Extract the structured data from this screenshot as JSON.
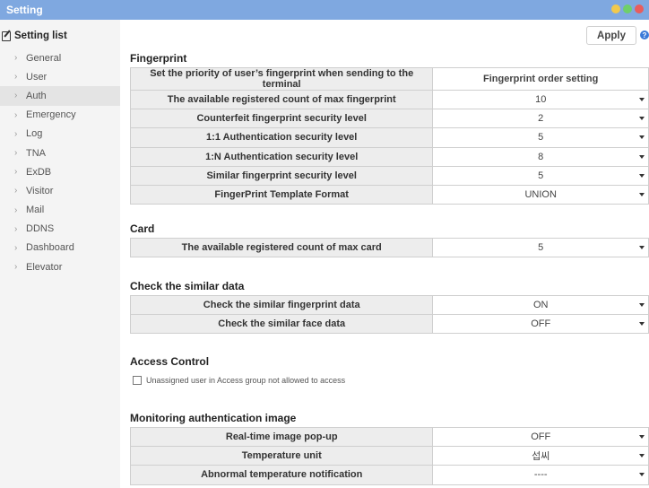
{
  "window": {
    "title": "Setting"
  },
  "sidebar": {
    "header": "Setting list",
    "items": [
      {
        "label": "General"
      },
      {
        "label": "User"
      },
      {
        "label": "Auth",
        "active": true
      },
      {
        "label": "Emergency"
      },
      {
        "label": "Log"
      },
      {
        "label": "TNA"
      },
      {
        "label": "ExDB"
      },
      {
        "label": "Visitor"
      },
      {
        "label": "Mail"
      },
      {
        "label": "DDNS"
      },
      {
        "label": "Dashboard"
      },
      {
        "label": "Elevator"
      }
    ]
  },
  "toolbar": {
    "apply_label": "Apply",
    "help_icon": "?"
  },
  "fingerprint": {
    "title": "Fingerprint",
    "priority_label": "Set the priority of user’s fingerprint when sending to the terminal",
    "priority_button": "Fingerprint order setting",
    "rows": [
      {
        "label": "The available registered count of max fingerprint",
        "value": "10"
      },
      {
        "label": "Counterfeit fingerprint security level",
        "value": "2"
      },
      {
        "label": "1:1 Authentication security level",
        "value": "5"
      },
      {
        "label": "1:N Authentication security level",
        "value": "8"
      },
      {
        "label": "Similar fingerprint security level",
        "value": "5"
      },
      {
        "label": "FingerPrint Template Format",
        "value": "UNION"
      }
    ]
  },
  "card": {
    "title": "Card",
    "rows": [
      {
        "label": "The available registered count of max card",
        "value": "5"
      }
    ]
  },
  "similar": {
    "title": "Check the similar data",
    "rows": [
      {
        "label": "Check the similar fingerprint data",
        "value": "ON"
      },
      {
        "label": "Check the similar face data",
        "value": "OFF"
      }
    ]
  },
  "access_control": {
    "title": "Access Control",
    "checkbox_label": "Unassigned user in Access group not allowed to access",
    "checked": false
  },
  "monitoring": {
    "title": "Monitoring authentication image",
    "rows": [
      {
        "label": "Real-time image pop-up",
        "value": "OFF"
      },
      {
        "label": "Temperature unit",
        "value": "섭씨"
      },
      {
        "label": "Abnormal temperature notification",
        "value": "----"
      }
    ]
  }
}
